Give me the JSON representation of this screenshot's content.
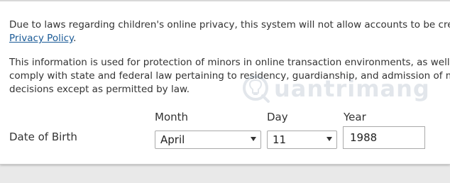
{
  "privacy_notice": {
    "line1": "Due to laws regarding children's online privacy, this system will not allow accounts to be crea",
    "link_text": "Privacy Policy",
    "link_suffix": "."
  },
  "info_notice": {
    "line1": "This information is used for protection of minors in online transaction environments, as well a",
    "line2": "comply with state and federal law pertaining to residency, guardianship, and admission of mi",
    "line3": "decisions except as permitted by law."
  },
  "watermark": {
    "text": "uantrimang",
    "logo_icon": "lightbulb-q-logo"
  },
  "dob": {
    "label": "Date of Birth",
    "month_label": "Month",
    "day_label": "Day",
    "year_label": "Year",
    "month_value": "April",
    "day_value": "11",
    "year_value": "1988"
  }
}
